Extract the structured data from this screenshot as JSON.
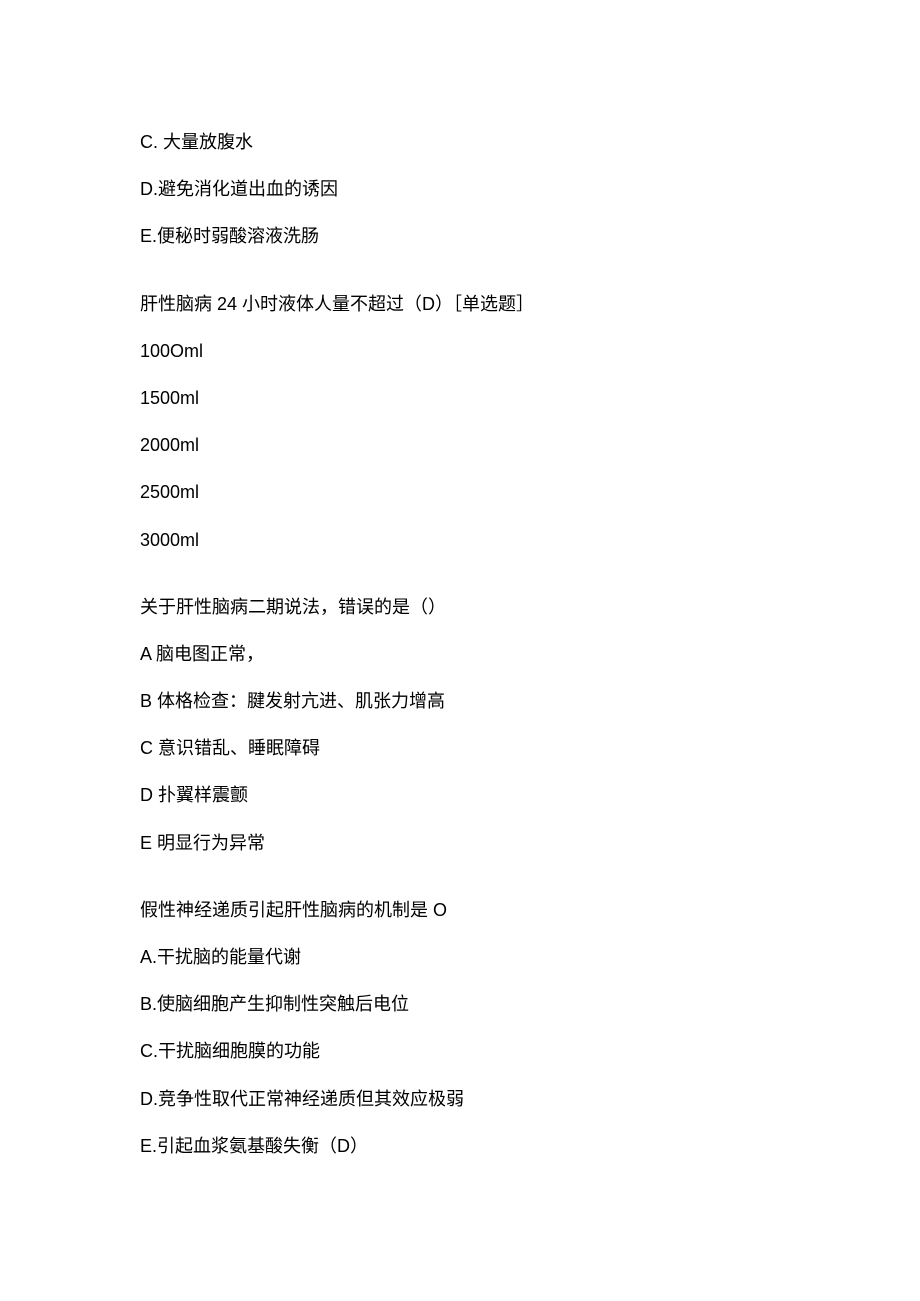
{
  "block1": {
    "optC": "C. 大量放腹水",
    "optD": "D.避免消化道出血的诱因",
    "optE": "E.便秘时弱酸溶液洗肠"
  },
  "block2": {
    "stem": "肝性脑病 24 小时液体人量不超过（D）［单选题］",
    "opt1": "100Oml",
    "opt2": "1500ml",
    "opt3": "2000ml",
    "opt4": "2500ml",
    "opt5": "3000ml"
  },
  "block3": {
    "stem": "关于肝性脑病二期说法，错误的是（）",
    "optA": "A 脑电图正常，",
    "optB": "B 体格检查：腱发射亢进、肌张力增高",
    "optC": "C 意识错乱、睡眠障碍",
    "optD": "D 扑翼样震颤",
    "optE": "E 明显行为异常"
  },
  "block4": {
    "stem": "假性神经递质引起肝性脑病的机制是 O",
    "optA": "A.干扰脑的能量代谢",
    "optB": "B.使脑细胞产生抑制性突触后电位",
    "optC": "C.干扰脑细胞膜的功能",
    "optD": "D.竞争性取代正常神经递质但其效应极弱",
    "optE": "E.引起血浆氨基酸失衡（D）"
  }
}
